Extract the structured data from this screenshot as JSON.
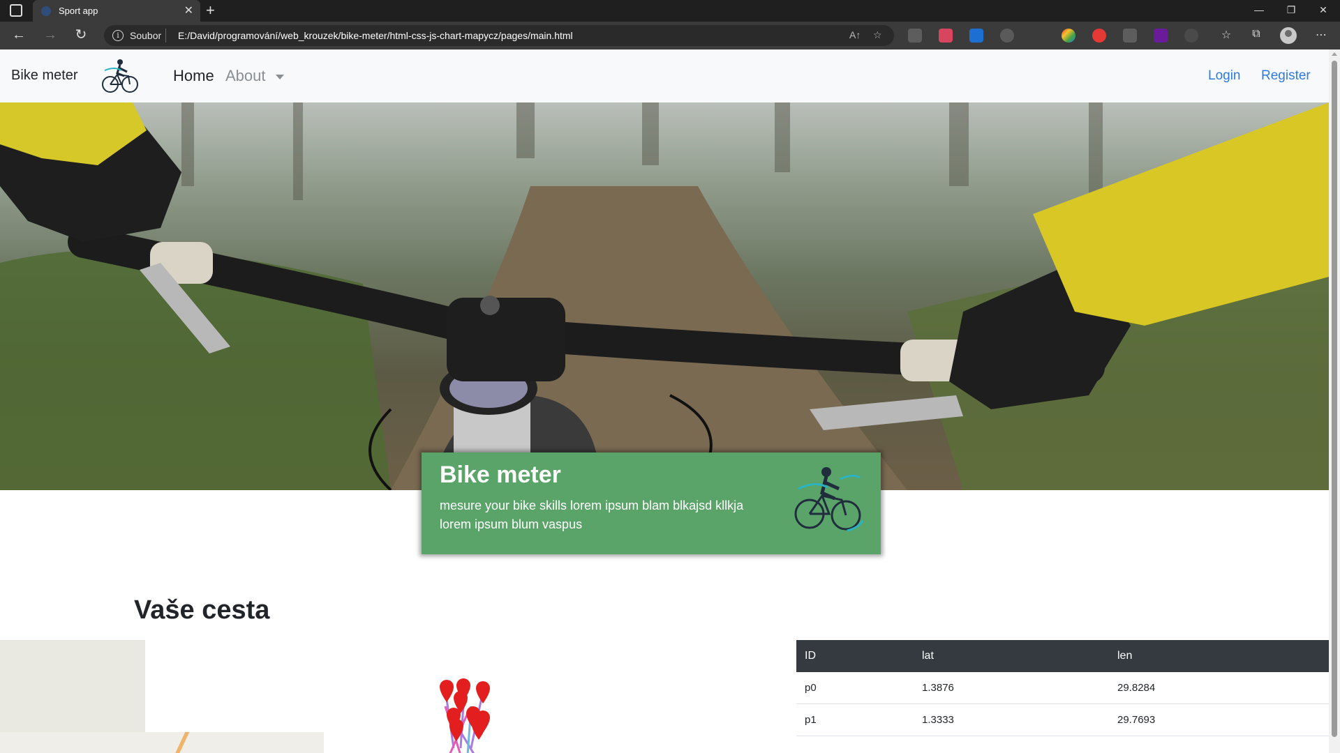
{
  "browser": {
    "tab_title": "Sport app",
    "site_chip": "Soubor",
    "url": "E:/David/programování/web_krouzek/bike-meter/html-css-js-chart-mapycz/pages/main.html"
  },
  "navbar": {
    "brand": "Bike meter",
    "home": "Home",
    "about": "About",
    "login": "Login",
    "register": "Register"
  },
  "hero_card": {
    "title": "Bike meter",
    "text": "mesure your bike skills lorem ipsum blam blkajsd kllkja lorem ipsum blum vaspus"
  },
  "section": {
    "title": "Vaše cesta"
  },
  "map": {
    "zoom_out": "−",
    "zoom_in": "+"
  },
  "table": {
    "columns": [
      "ID",
      "lat",
      "len"
    ],
    "rows": [
      {
        "id": "p0",
        "lat": "1.3876",
        "len": "29.8284"
      },
      {
        "id": "p1",
        "lat": "1.3333",
        "len": "29.7693"
      }
    ]
  },
  "colors": {
    "card_green": "#5aa469",
    "link_blue": "#2f7ae0",
    "table_head": "#343a40",
    "pin_red": "#e21e1e"
  }
}
